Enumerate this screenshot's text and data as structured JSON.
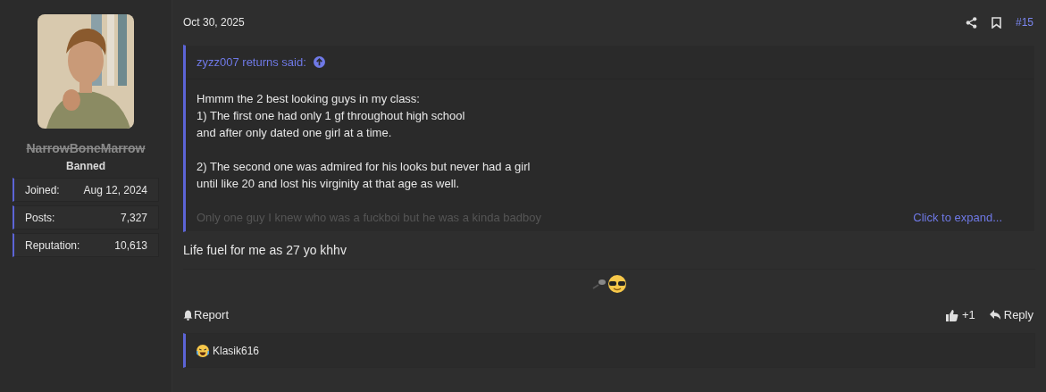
{
  "user": {
    "name": "NarrowBoneMarrow",
    "banned": true,
    "title": "Banned",
    "stats": [
      {
        "label": "Joined:",
        "value": "Aug 12, 2024"
      },
      {
        "label": "Posts:",
        "value": "7,327"
      },
      {
        "label": "Reputation:",
        "value": "10,613"
      }
    ]
  },
  "post": {
    "date": "Oct 30, 2025",
    "number": "#15",
    "quote": {
      "author": "zyzz007 returns said:",
      "paragraphs": [
        [
          "Hmmm the 2 best looking guys in my class:",
          "1) The first one had only 1 gf throughout high school",
          "and after only dated one girl at a time."
        ],
        [
          "2) The second one was admired for his looks but never had a girl",
          "until like 20 and lost his virginity at that age as well."
        ]
      ],
      "faded_line": "Only one guy I knew who was a fuckboi but he was a kinda badboy",
      "expand": "Click to expand..."
    },
    "message": "Life fuel for me as 27 yo khhv",
    "actions": {
      "report": "Report",
      "like_count": "+1",
      "reply": "Reply"
    },
    "reactions": [
      {
        "user": "Klasik616"
      }
    ]
  }
}
